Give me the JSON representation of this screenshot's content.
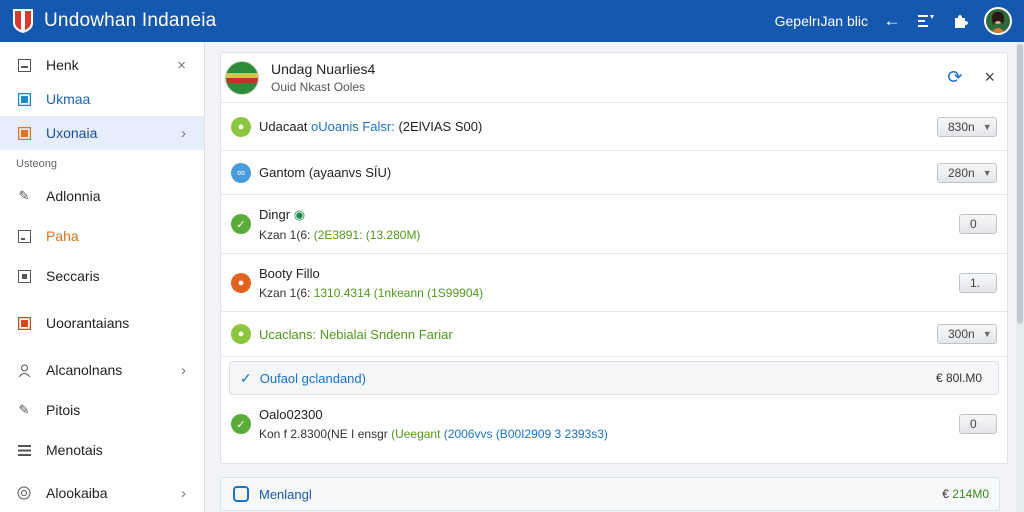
{
  "topbar": {
    "title": "Undowhan Indaneia",
    "link": "GepelrıJan blic",
    "icons": [
      "back-arrow-icon",
      "list-arrow-icon",
      "puzzle-icon"
    ]
  },
  "sidebar": {
    "items": [
      {
        "label": "Henk",
        "icon": "square-icon",
        "active": false,
        "close": true
      },
      {
        "label": "Ukmaa",
        "icon": "square-icon",
        "active": false
      },
      {
        "label": "Uxonaia",
        "icon": "square-icon",
        "active": true,
        "chevron": true
      }
    ],
    "section": "Usteong",
    "items2": [
      {
        "label": "Adlonnia",
        "icon": "pencil-icon"
      },
      {
        "label": "Paha",
        "icon": "square-icon"
      },
      {
        "label": "Seccaris",
        "icon": "square-icon"
      },
      {
        "label": "Uoorantaians",
        "icon": "square-icon"
      },
      {
        "label": "Alcanolnans",
        "icon": "person-icon",
        "chevron": true
      },
      {
        "label": "Pitois",
        "icon": "pencil-icon"
      },
      {
        "label": "Menotais",
        "icon": "list-icon"
      },
      {
        "label": "Alookaiba",
        "icon": "target-icon",
        "chevron": true
      }
    ]
  },
  "main": {
    "header": {
      "title": "Undag Nuarlies4",
      "subtitle": "Ouid Nkast Ooles"
    },
    "rows": [
      {
        "icon_color": "#8cc63f",
        "text_a": "Udacaat ",
        "text_b": "oUoanis Falsr:",
        "text_c": " (2ElVIAS S00)",
        "dropdown": "830n"
      },
      {
        "icon_color": "#4a9bdc",
        "text_a": "Gantom (ayaanvs SÍU)",
        "dropdown": "280n"
      },
      {
        "icon_color": "#5aab3a",
        "title": "Dingr",
        "sub_a": "Kzan 1(6: ",
        "sub_b": "(2E3891: (13.280M)",
        "dropdown": "0"
      },
      {
        "icon_color": "#e2631f",
        "title": "Booty Fillo",
        "sub_a": "Kzan 1(6: ",
        "sub_b": "1310.4314 (1nkeann (1S99904)",
        "dropdown": "1."
      },
      {
        "icon_color": "#8cc63f",
        "text_b": "Ucaclans: Nebialai Sndenn Fariar",
        "dropdown": "300n"
      },
      {
        "check": "✓",
        "text_blue": "Oufaol gclandand)",
        "amount": "€ 80l.M0"
      },
      {
        "icon_color": "#5aab3a",
        "title": "Oalo02300",
        "sub_a": "Kon f 2.8300(NE I ensgr ",
        "sub_b": "(Ueegant",
        "sub_c": " (2006vvs (B00I2909 3 2393s3)",
        "dropdown": "0"
      }
    ]
  },
  "footer": {
    "label": "Menlangl",
    "amount_prefix": "€ ",
    "amount": "214M0"
  }
}
